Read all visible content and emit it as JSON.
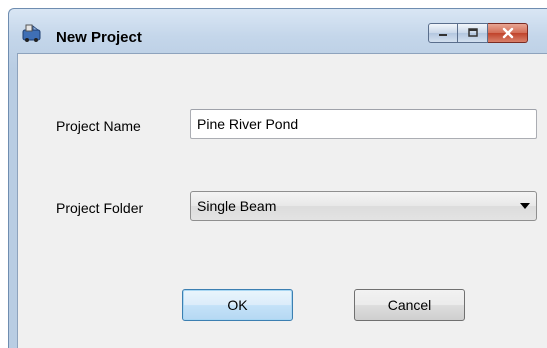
{
  "window": {
    "title": "New Project",
    "icon": "app-icon"
  },
  "caption_buttons": {
    "minimize_icon": "minimize-icon",
    "maximize_icon": "maximize-icon",
    "close_icon": "close-icon"
  },
  "form": {
    "project_name_label": "Project Name",
    "project_name_value": "Pine River Pond",
    "project_folder_label": "Project Folder",
    "project_folder_value": "Single Beam"
  },
  "buttons": {
    "ok_label": "OK",
    "cancel_label": "Cancel"
  },
  "colors": {
    "title_bar": "#c4d6ea",
    "client_background": "#f0f0f0",
    "close_button": "#c0432b",
    "default_button_border": "#3c7fb1"
  }
}
